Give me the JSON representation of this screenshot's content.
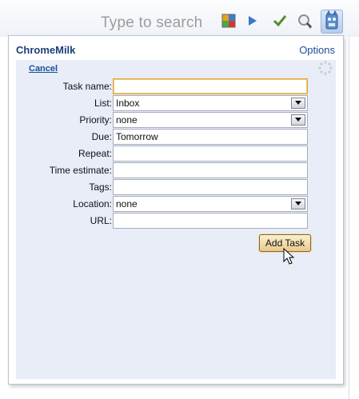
{
  "toolbar": {
    "search_placeholder": "Type to search",
    "icons": [
      "feed-icon",
      "play-icon",
      "checkmark-icon",
      "search-icon",
      "chromemilk-icon"
    ]
  },
  "popup": {
    "title": "ChromeMilk",
    "options_label": "Options",
    "cancel_label": "Cancel",
    "add_task_label": "Add Task"
  },
  "form": {
    "task_name": {
      "label": "Task name:",
      "value": ""
    },
    "list": {
      "label": "List:",
      "value": "Inbox"
    },
    "priority": {
      "label": "Priority:",
      "value": "none"
    },
    "due": {
      "label": "Due:",
      "value": "Tomorrow"
    },
    "repeat": {
      "label": "Repeat:",
      "value": ""
    },
    "time_estimate": {
      "label": "Time estimate:",
      "value": ""
    },
    "tags": {
      "label": "Tags:",
      "value": ""
    },
    "location": {
      "label": "Location:",
      "value": "none"
    },
    "url": {
      "label": "URL:",
      "value": ""
    }
  },
  "colors": {
    "panel_bg": "#e8edf8",
    "title": "#1a3f7a",
    "link": "#1a4e9c",
    "focus_border": "#e3a53b",
    "button_bg": "#e9c98a"
  }
}
